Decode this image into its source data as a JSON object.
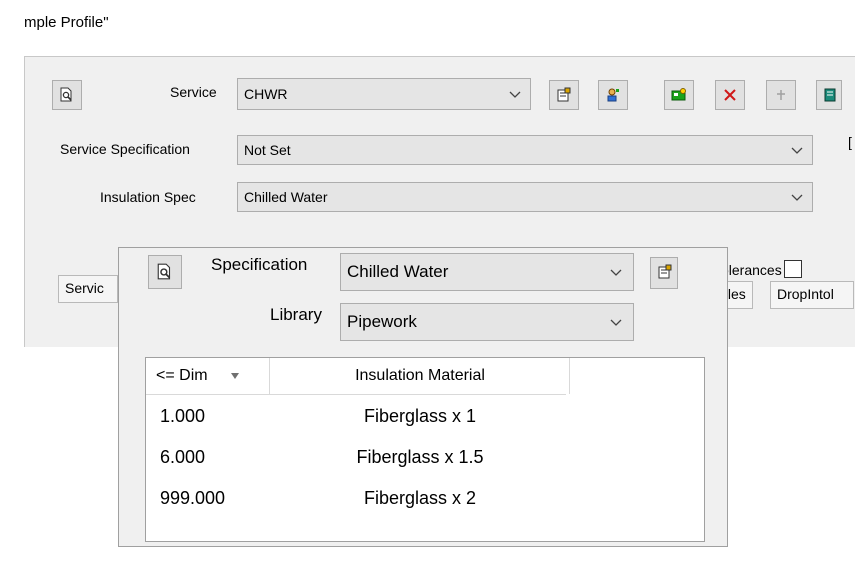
{
  "window": {
    "title": "mple Profile\""
  },
  "top_form": {
    "service_label": "Service",
    "service_value": "CHWR",
    "service_spec_label": "Service Specification",
    "service_spec_value": "Not Set",
    "insulation_spec_label": "Insulation Spec",
    "insulation_spec_value": "Chilled Water",
    "tolerances_label": "Tolerances",
    "tolerances_checked": false
  },
  "tabs": [
    {
      "label": "Servic"
    },
    {
      "label": "Offset Rules"
    },
    {
      "label": "DropIntol"
    }
  ],
  "dialog": {
    "specification_label": "Specification",
    "specification_value": "Chilled Water",
    "library_label": "Library",
    "library_value": "Pipework",
    "table": {
      "headers": [
        "<= Dim",
        "Insulation Material"
      ],
      "rows": [
        {
          "dim": "1.000",
          "material": "Fiberglass x 1"
        },
        {
          "dim": "6.000",
          "material": "Fiberglass x 1.5"
        },
        {
          "dim": "999.000",
          "material": "Fiberglass x 2"
        }
      ]
    }
  },
  "icons": {
    "preview": "page-magnifier-icon",
    "properties": "properties-icon",
    "user": "user-icon",
    "add": "add-item-icon",
    "delete": "delete-x-icon",
    "pin": "pin-icon",
    "book": "book-icon",
    "dropdown": "chevron-down-icon",
    "sort": "sort-down-icon"
  },
  "colors": {
    "panel": "#f0f0f0",
    "combo": "#e5e5e5",
    "delete_red": "#d01818",
    "add_green": "#1aa31a"
  }
}
